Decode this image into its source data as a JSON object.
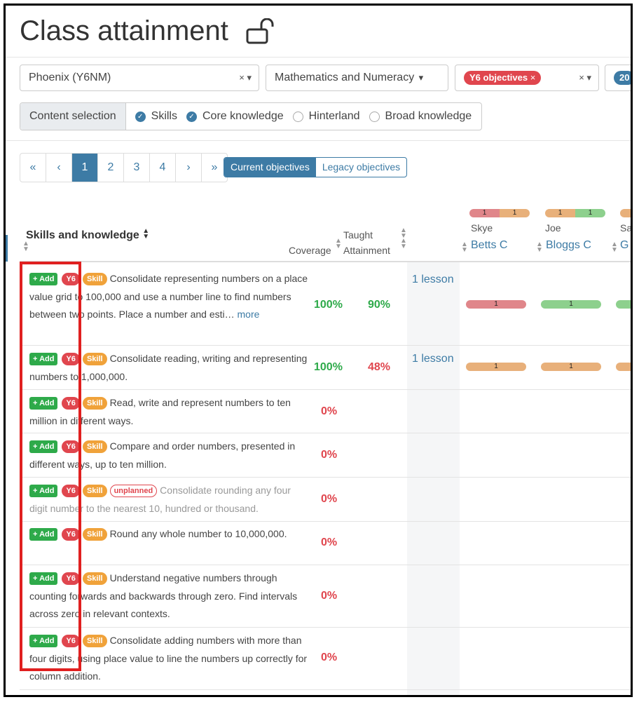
{
  "title": "Class attainment",
  "filters": {
    "class": "Phoenix (Y6NM)",
    "subject": "Mathematics and Numeracy",
    "objectives_tag": "Y6 objectives",
    "overflow_tag": "20",
    "clear_symbol": "×",
    "caret": "▾"
  },
  "content_selection": {
    "label": "Content selection",
    "options": [
      {
        "label": "Skills",
        "checked": true
      },
      {
        "label": "Core knowledge",
        "checked": true
      },
      {
        "label": "Hinterland",
        "checked": false
      },
      {
        "label": "Broad knowledge",
        "checked": false
      }
    ]
  },
  "pagination": [
    "«",
    "‹",
    "1",
    "2",
    "3",
    "4",
    "›",
    "»"
  ],
  "objective_toggle": {
    "current": "Current objectives",
    "legacy": "Legacy objectives"
  },
  "table": {
    "skills_header": "Skills and knowledge",
    "coverage_header": "Coverage",
    "taught_header": "Taught",
    "attainment_header": "Attainment",
    "students": [
      {
        "first": "Skye",
        "last": "Betts C",
        "bar": [
          "1",
          "1"
        ]
      },
      {
        "first": "Joe",
        "last": "Bloggs C",
        "bar": [
          "1",
          "1"
        ]
      },
      {
        "first": "Sa",
        "last": "G",
        "bar": []
      }
    ],
    "add_label": "+ Add",
    "y6_label": "Y6",
    "skill_label": "Skill",
    "unplanned_label": "unplanned",
    "more_label": "more",
    "rows": [
      {
        "text": "Consolidate representing numbers on a place value grid to 100,000 and use a number line to find numbers between two points. Place a number and esti…",
        "coverage": "100%",
        "attainment": "90%",
        "lessons": "1 lesson",
        "cells": [
          "1",
          "1"
        ]
      },
      {
        "text": "Consolidate reading, writing and representing numbers to 1,000,000.",
        "coverage": "100%",
        "attainment": "48%",
        "lessons": "1 lesson",
        "cells": [
          "1",
          "1"
        ]
      },
      {
        "text": "Read, write and represent numbers to ten million in different ways.",
        "coverage": "0%"
      },
      {
        "text": "Compare and order numbers, presented in different ways, up to ten million.",
        "coverage": "0%"
      },
      {
        "text": "Consolidate rounding any four digit number to the nearest 10, hundred or thousand.",
        "coverage": "0%"
      },
      {
        "text": "Round any whole number to 10,000,000.",
        "coverage": "0%"
      },
      {
        "text": "Understand negative numbers through counting forwards and backwards through zero. Find intervals across zero in relevant contexts.",
        "coverage": "0%"
      },
      {
        "text": "Consolidate adding numbers with more than four digits, using place value to line the numbers up correctly for column addition.",
        "coverage": "0%"
      }
    ]
  },
  "colors": {
    "accent": "#3d7ba5",
    "success": "#2eaa4a",
    "danger": "#e0464e",
    "warning": "#f0a23a",
    "highlight_box": "#e02020"
  }
}
